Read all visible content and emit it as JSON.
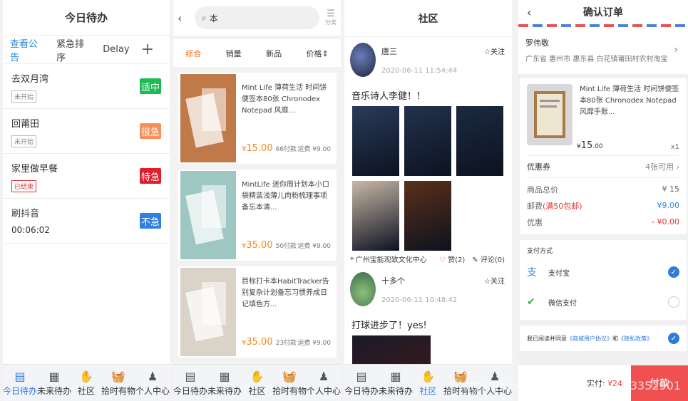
{
  "tabs": [
    "今日待办",
    "未来待办",
    "社区",
    "拾时有物",
    "个人中心"
  ],
  "todo": {
    "title": "今日待办",
    "toolbar": [
      "查看公告",
      "紧急排序",
      "Delay"
    ],
    "plus": "+",
    "items": [
      {
        "title": "去双月湾",
        "status": "未开始",
        "badge": "适中",
        "badge_color": "#1db954"
      },
      {
        "title": "回莆田",
        "status": "未开始",
        "badge": "很急",
        "badge_color": "#f6905a"
      },
      {
        "title": "家里做早餐",
        "status": "已结束",
        "badge": "特急",
        "badge_color": "#e21d2c"
      },
      {
        "title": "刷抖音",
        "time": "00:06:02",
        "badge": "不急",
        "badge_color": "#2f80e0"
      }
    ]
  },
  "shop": {
    "back": "‹",
    "search_value": "本",
    "category_label": "分类",
    "sort": [
      "综合",
      "销量",
      "新品",
      "价格⇕"
    ],
    "goods": [
      {
        "name": "Mint Life 薄荷生活 时间饼便签本80张 Chronodex Notepad 风靡...",
        "price": "15.00",
        "sold": "66付款",
        "ship": "运费 ¥9.00",
        "img": "#c07a4a"
      },
      {
        "name": "MintLife 迷你周计划本小口袋精装浅薄儿肉粉梳理事项备忘本清...",
        "price": "35.00",
        "sold": "50付款",
        "ship": "运费 ¥9.00",
        "img": "#9fc7c2"
      },
      {
        "name": "目标打卡本HabitTracker告别复杂计划备忘习惯养成日记填色方...",
        "price": "35.00",
        "sold": "23付款",
        "ship": "运费 ¥9.00",
        "img": "#d9d3c8"
      }
    ]
  },
  "community": {
    "title": "社区",
    "posts": [
      {
        "user": "唐三",
        "date": "2020-06-11 11:54:44",
        "follow": "☆关注",
        "text": "音乐诗人李健！！",
        "location": "广州宝能观致文化中心",
        "likes": "赞(2)",
        "comments": "评论(0)",
        "pics": [
          "#2a3b5a",
          "#23324e",
          "#1c2a40",
          "#c8b8a8",
          "#5a3018"
        ]
      },
      {
        "user": "十多个",
        "date": "2020-06-11 10:48:42",
        "follow": "☆关注",
        "text": "打球进步了！yes!",
        "pics": [
          "#1a1a2a"
        ]
      }
    ]
  },
  "order": {
    "title": "确认订单",
    "back": "‹",
    "name": "罗伟敬",
    "address": "广东省 惠州市 惠东县 白花镇莆田村农村淘宝",
    "product": "Mint Life 薄荷生活 时间饼便签本80张 Chronodex Notepad 风靡手账...",
    "price_int": "15",
    "price_dec": ".00",
    "price_symbol": "¥",
    "qty": "x1",
    "coupon_label": "优惠券",
    "coupon_value": "4张可用 ›",
    "fees": [
      {
        "label": "商品总价",
        "value": "¥ 15",
        "cls": ""
      },
      {
        "label": "邮费",
        "note": "(满50包邮)",
        "value": "¥9.00",
        "cls": "blue"
      },
      {
        "label": "优惠",
        "value": "- ¥0.00",
        "cls": "red"
      }
    ],
    "pay_title": "支付方式",
    "pay_methods": [
      {
        "label": "支付宝",
        "checked": true,
        "icon": "支",
        "color": "#2f8ad8"
      },
      {
        "label": "微信支付",
        "checked": false,
        "icon": "✔",
        "color": "#3bb54a"
      }
    ],
    "agree_prefix": "我已阅读并同意",
    "agree_link1": "《商城用户协议》",
    "agree_and": "和",
    "agree_link2": "《隐私政策》",
    "total_label": "实付:",
    "total_value": "¥24",
    "submit": "付款",
    "watermark": "https://blog.csdn.net/weixin_43352901"
  }
}
